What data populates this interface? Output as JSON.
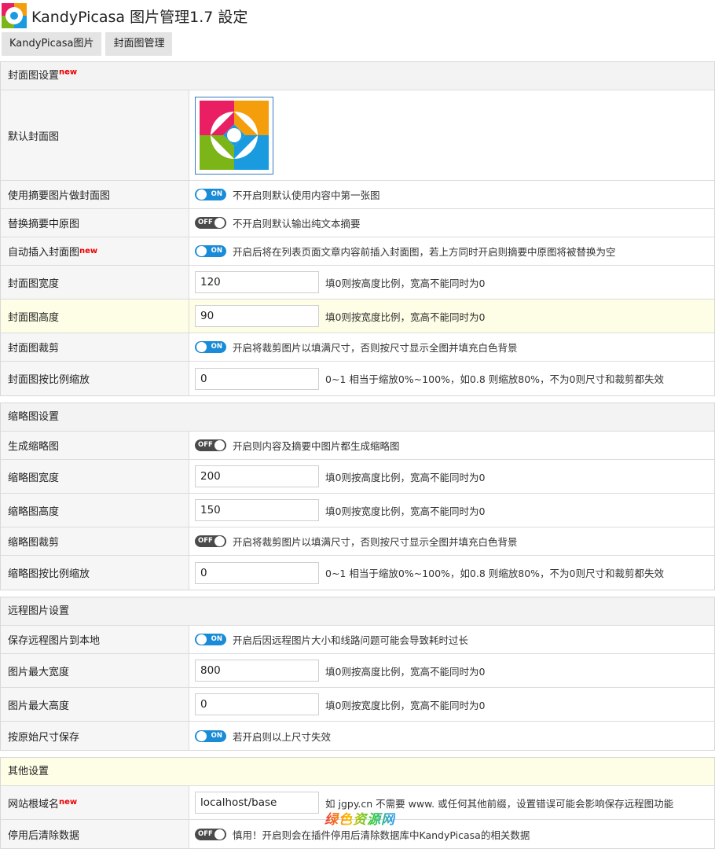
{
  "header": {
    "title": "KandyPicasa 图片管理1.7 設定"
  },
  "tabs": [
    {
      "label": "KandyPicasa图片"
    },
    {
      "label": "封面图管理"
    }
  ],
  "new_badge": "new",
  "cover": {
    "heading": "封面图设置",
    "default_label": "默认封面图",
    "use_excerpt": {
      "label": "使用摘要图片做封面图",
      "state": "ON",
      "desc": "不开启则默认使用内容中第一张图"
    },
    "replace_excerpt": {
      "label": "替换摘要中原图",
      "state": "OFF",
      "desc": "不开启则默认输出纯文本摘要"
    },
    "auto_insert": {
      "label": "自动插入封面图",
      "state": "ON",
      "desc": "开启后将在列表页面文章内容前插入封面图，若上方同时开启则摘要中原图将被替换为空"
    },
    "width": {
      "label": "封面图宽度",
      "value": "120",
      "desc": "填0则按高度比例，宽高不能同时为0"
    },
    "height": {
      "label": "封面图高度",
      "value": "90",
      "desc": "填0则按宽度比例，宽高不能同时为0"
    },
    "crop": {
      "label": "封面图裁剪",
      "state": "ON",
      "desc": "开启将裁剪图片以填满尺寸，否则按尺寸显示全图并填充白色背景"
    },
    "scale": {
      "label": "封面图按比例缩放",
      "value": "0",
      "desc": "0~1 相当于缩放0%~100%，如0.8 则缩放80%，不为0则尺寸和裁剪都失效"
    }
  },
  "thumb": {
    "heading": "缩略图设置",
    "generate": {
      "label": "生成缩略图",
      "state": "OFF",
      "desc": "开启则内容及摘要中图片都生成缩略图"
    },
    "width": {
      "label": "缩略图宽度",
      "value": "200",
      "desc": "填0则按高度比例，宽高不能同时为0"
    },
    "height": {
      "label": "缩略图高度",
      "value": "150",
      "desc": "填0则按宽度比例，宽高不能同时为0"
    },
    "crop": {
      "label": "缩略图裁剪",
      "state": "OFF",
      "desc": "开启将裁剪图片以填满尺寸，否则按尺寸显示全图并填充白色背景"
    },
    "scale": {
      "label": "缩略图按比例缩放",
      "value": "0",
      "desc": "0~1 相当于缩放0%~100%，如0.8 则缩放80%，不为0则尺寸和裁剪都失效"
    }
  },
  "remote": {
    "heading": "远程图片设置",
    "save_local": {
      "label": "保存远程图片到本地",
      "state": "ON",
      "desc": "开启后因远程图片大小和线路问题可能会导致耗时过长"
    },
    "max_width": {
      "label": "图片最大宽度",
      "value": "800",
      "desc": "填0则按高度比例，宽高不能同时为0"
    },
    "max_height": {
      "label": "图片最大高度",
      "value": "0",
      "desc": "填0则按宽度比例，宽高不能同时为0"
    },
    "original": {
      "label": "按原始尺寸保存",
      "state": "ON",
      "desc": "若开启则以上尺寸失效"
    }
  },
  "other": {
    "heading": "其他设置",
    "domain": {
      "label": "网站根域名",
      "value": "localhost/base",
      "desc": "如 jgpy.cn 不需要 www. 或任何其他前缀，设置错误可能会影响保存远程图功能"
    },
    "clear": {
      "label": "停用后清除数据",
      "state": "OFF",
      "desc": "慎用！开启则会在插件停用后清除数据库中KandyPicasa的相关数据"
    }
  },
  "watermark": "绿色资源网",
  "colors": {
    "on": "#1a8bd6",
    "off": "#4a4a4a",
    "highlight": "#fefde6",
    "new": "#e00000"
  }
}
